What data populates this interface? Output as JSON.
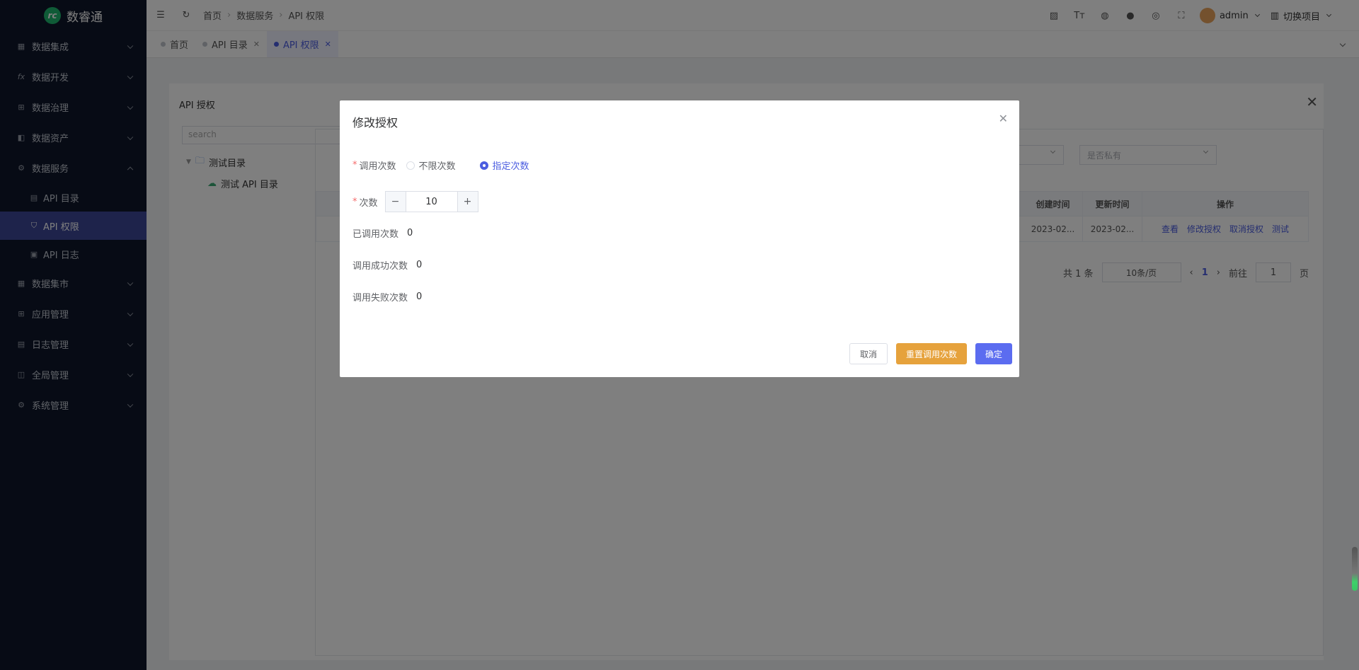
{
  "app": {
    "name": "数睿通"
  },
  "sidebar": {
    "items": [
      {
        "label": "数据集成",
        "icon": "grid-icon"
      },
      {
        "label": "数据开发",
        "icon": "fx-icon"
      },
      {
        "label": "数据治理",
        "icon": "table-icon"
      },
      {
        "label": "数据资产",
        "icon": "asset-icon"
      },
      {
        "label": "数据服务",
        "icon": "gear-icon",
        "expanded": true
      },
      {
        "label": "数据集市",
        "icon": "market-icon"
      },
      {
        "label": "应用管理",
        "icon": "apps-icon"
      },
      {
        "label": "日志管理",
        "icon": "log-icon"
      },
      {
        "label": "全局管理",
        "icon": "global-icon"
      },
      {
        "label": "系统管理",
        "icon": "settings-icon"
      }
    ],
    "sub_items": [
      {
        "label": "API 目录"
      },
      {
        "label": "API 权限",
        "active": true
      },
      {
        "label": "API 日志"
      }
    ]
  },
  "header": {
    "breadcrumb": [
      "首页",
      "数据服务",
      "API 权限"
    ],
    "user": "admin",
    "switch_project": "切换项目"
  },
  "tabs": [
    {
      "label": "首页",
      "closable": false
    },
    {
      "label": "API 目录",
      "closable": true
    },
    {
      "label": "API 权限",
      "closable": true,
      "active": true
    }
  ],
  "panel": {
    "title": "API 授权",
    "search_placeholder": "search",
    "tree": {
      "root": "测试目录",
      "child": "测试 API 目录"
    },
    "filter_private": "是否私有",
    "table": {
      "headers": [
        "创建时间",
        "更新时间",
        "操作"
      ],
      "row": {
        "created": "2023-02...",
        "updated": "2023-02...",
        "actions": [
          "查看",
          "修改授权",
          "取消授权",
          "测试"
        ]
      }
    },
    "pager": {
      "total": "共 1 条",
      "page_size": "10条/页",
      "current": "1",
      "goto_label": "前往",
      "goto_value": "1",
      "page_unit": "页"
    }
  },
  "dialog": {
    "title": "修改授权",
    "call_count_label": "调用次数",
    "options": [
      "不限次数",
      "指定次数"
    ],
    "count_label": "次数",
    "count_value": "10",
    "called_label": "已调用次数",
    "called_value": "0",
    "success_label": "调用成功次数",
    "success_value": "0",
    "fail_label": "调用失败次数",
    "fail_value": "0",
    "buttons": {
      "cancel": "取消",
      "reset": "重置调用次数",
      "ok": "确定"
    }
  },
  "colors": {
    "primary": "#5b6cf0",
    "warning": "#e6a23c",
    "sidebar_bg": "#0f172a",
    "sidebar_active": "#3c4796"
  }
}
